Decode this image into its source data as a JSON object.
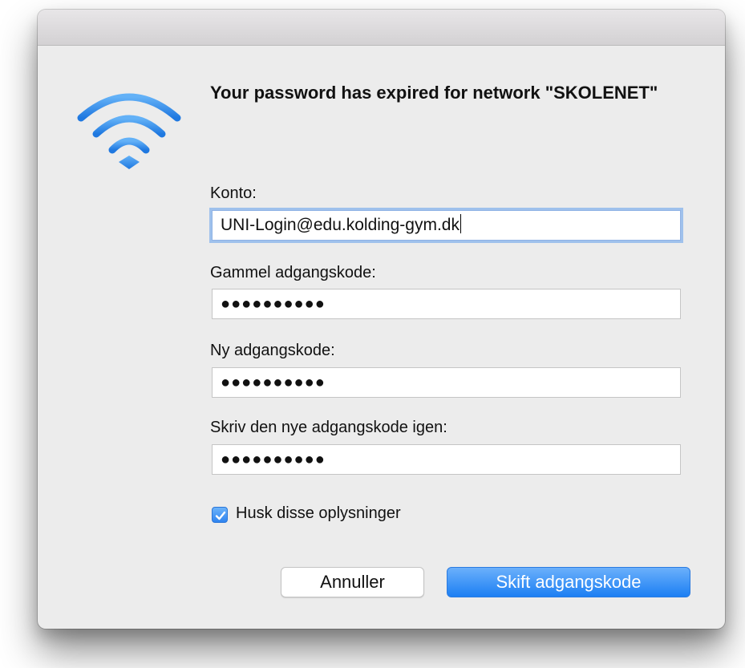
{
  "dialog": {
    "headline": "Your password has expired for network \"SKOLENET\"",
    "icon": "wifi-icon"
  },
  "fields": {
    "account": {
      "label": "Konto:",
      "value": "UNI-Login@edu.kolding-gym.dk"
    },
    "old_password": {
      "label": "Gammel adgangskode:",
      "value": "●●●●●●●●●●"
    },
    "new_password": {
      "label": "Ny adgangskode:",
      "value": "●●●●●●●●●●"
    },
    "confirm_password": {
      "label": "Skriv den nye adgangskode igen:",
      "value": "●●●●●●●●●●"
    }
  },
  "remember": {
    "label": "Husk disse oplysninger",
    "checked": true
  },
  "buttons": {
    "cancel": "Annuller",
    "submit": "Skift adgangskode"
  },
  "colors": {
    "accent": "#2f84f0",
    "wifi": "#3a94ec"
  }
}
